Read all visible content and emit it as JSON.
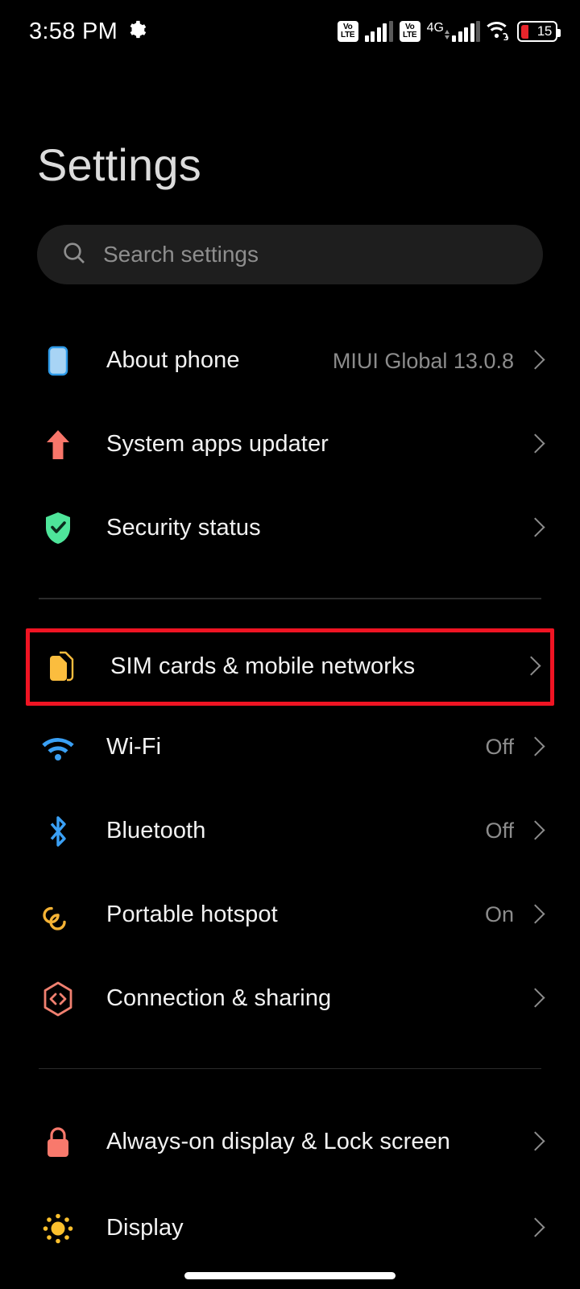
{
  "status_bar": {
    "time": "3:58 PM",
    "gear_icon": "gear-icon",
    "sim1_volte_top": "Vo",
    "sim1_volte_bottom": "LTE",
    "sim2_volte_top": "Vo",
    "sim2_volte_bottom": "LTE",
    "network_type": "4G",
    "wifi_icon": "wifi-icon",
    "battery_percent": "15",
    "battery_color": "#e8252b"
  },
  "header": {
    "title": "Settings"
  },
  "search": {
    "icon": "search-icon",
    "placeholder": "Search settings",
    "value": ""
  },
  "highlight": {
    "color": "#f01423"
  },
  "groups": [
    {
      "items": [
        {
          "label": "About phone",
          "value": "MIUI Global 13.0.8",
          "icon": "phone-icon",
          "icon_color": "#a8d4f5"
        },
        {
          "label": "System apps updater",
          "value": "",
          "icon": "arrow-up-icon",
          "icon_color": "#f8766a"
        },
        {
          "label": "Security status",
          "value": "",
          "icon": "shield-check-icon",
          "icon_color": "#4ee59a"
        }
      ]
    },
    {
      "items": [
        {
          "label": "SIM cards & mobile networks",
          "value": "",
          "icon": "sim-card-icon",
          "icon_color": "#fbbd3e",
          "highlighted": true
        },
        {
          "label": "Wi-Fi",
          "value": "Off",
          "icon": "wifi-icon",
          "icon_color": "#3aa0f5"
        },
        {
          "label": "Bluetooth",
          "value": "Off",
          "icon": "bluetooth-icon",
          "icon_color": "#3aa0f5"
        },
        {
          "label": "Portable hotspot",
          "value": "On",
          "icon": "hotspot-icon",
          "icon_color": "#f5b335"
        },
        {
          "label": "Connection & sharing",
          "value": "",
          "icon": "connection-sharing-icon",
          "icon_color": "#f08070"
        }
      ]
    },
    {
      "items": [
        {
          "label": "Always-on display & Lock screen",
          "value": "",
          "icon": "lock-icon",
          "icon_color": "#f8796c"
        },
        {
          "label": "Display",
          "value": "",
          "icon": "brightness-icon",
          "icon_color": "#fbc02d"
        }
      ]
    }
  ]
}
